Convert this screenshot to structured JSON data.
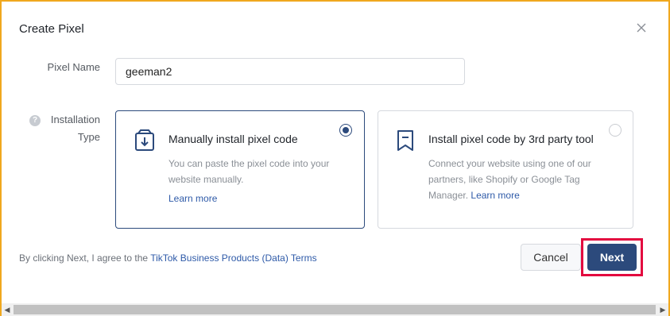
{
  "dialog": {
    "title": "Create Pixel",
    "close_icon": "close-icon"
  },
  "form": {
    "pixel_name_label": "Pixel Name",
    "pixel_name_value": "geeman2",
    "installation_label": "Installation Type",
    "help_icon_text": "?"
  },
  "options": {
    "manual": {
      "title": "Manually install pixel code",
      "description": "You can paste the pixel code into your website manually.",
      "learn_more": "Learn more",
      "selected": true,
      "icon": "download-box-icon"
    },
    "third_party": {
      "title": "Install pixel code by 3rd party tool",
      "description": "Connect your website using one of our partners, like Shopify or Google Tag Manager.",
      "learn_more": "Learn more",
      "selected": false,
      "icon": "bookmark-icon"
    }
  },
  "footer": {
    "agreement_prefix": "By clicking Next, I agree to the",
    "terms_link": "TikTok Business Products (Data) Terms",
    "cancel_label": "Cancel",
    "next_label": "Next"
  },
  "colors": {
    "accent": "#2c4a7c",
    "link": "#2e5aa8",
    "highlight": "#e3093f",
    "frame": "#f0a81e"
  },
  "scrollbar": {
    "left_arrow": "◀",
    "right_arrow": "▶"
  }
}
